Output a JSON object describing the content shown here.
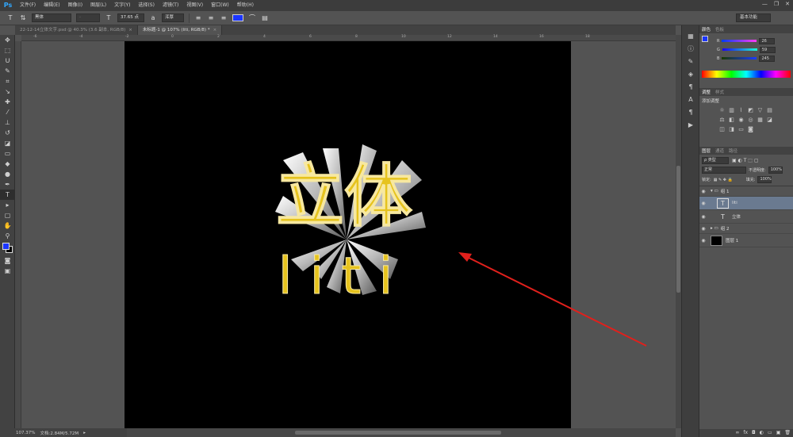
{
  "app": {
    "logo": "Ps"
  },
  "menu": [
    "文件(F)",
    "编辑(E)",
    "图像(I)",
    "图层(L)",
    "文字(Y)",
    "选择(S)",
    "滤镜(T)",
    "视图(V)",
    "窗口(W)",
    "帮助(H)"
  ],
  "window_controls": {
    "minimize": "—",
    "restore": "❐",
    "close": "✕"
  },
  "options": {
    "font_family": "黑体",
    "font_style": "-",
    "font_size": "37.65 点",
    "antialias": "浑厚",
    "text_color": "#1b35ff",
    "workspace": "基本功能"
  },
  "tabs": [
    {
      "label": "22-12-14立体文字.psd @ 40.3% (3.6 副本, RGB/8)",
      "close": "×"
    },
    {
      "label": "未标题-1 @ 107% (liti, RGB/8) *",
      "close": "×"
    }
  ],
  "ruler": {
    "top_ticks": [
      "-6",
      "-4",
      "-2",
      "0",
      "2",
      "4",
      "6",
      "8",
      "10",
      "12",
      "14",
      "16",
      "18"
    ]
  },
  "status": {
    "zoom": "107.37%",
    "doc": "文档:2.84M/5.72M"
  },
  "canvas_text": {
    "top": "立体",
    "bottom": "liti"
  },
  "colors": {
    "text_gold": "#e6c31e",
    "fg": "#1b35ff",
    "bg": "#000000",
    "arrow": "#e0201c"
  },
  "color_panel": {
    "tabs": [
      "颜色",
      "色板"
    ],
    "rows": [
      {
        "label": "R",
        "value": "26"
      },
      {
        "label": "G",
        "value": "59"
      },
      {
        "label": "B",
        "value": "245"
      }
    ]
  },
  "adjust_panel": {
    "tabs": [
      "调整",
      "样式"
    ],
    "title": "添加调整"
  },
  "layers_panel": {
    "tabs": [
      "图层",
      "通道",
      "路径"
    ],
    "filter": "ρ 类型",
    "blend": "正常",
    "opacity_label": "不透明度:",
    "opacity": "100%",
    "lock_label": "锁定:",
    "fill_label": "填充:",
    "fill": "100%",
    "layers": [
      {
        "name": "组 1",
        "kind": "group-open"
      },
      {
        "name": "liti",
        "kind": "text",
        "selected": true
      },
      {
        "name": "立体",
        "kind": "text"
      },
      {
        "name": "组 2",
        "kind": "group-closed"
      },
      {
        "name": "图层 1",
        "kind": "fill"
      }
    ]
  }
}
